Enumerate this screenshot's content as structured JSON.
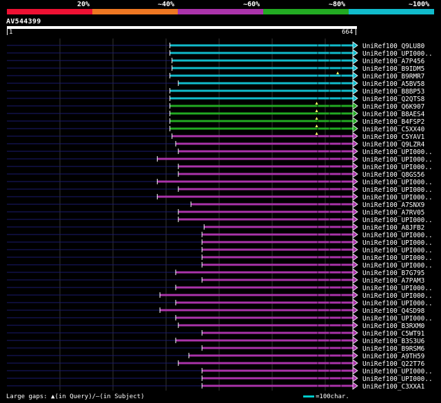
{
  "legend": {
    "labels": [
      "20%",
      "~40%",
      "~60%",
      "~80%",
      "~100%"
    ],
    "colors": [
      "#ee1133",
      "#ee7722",
      "#aa33aa",
      "#22aa22",
      "#11bbcc"
    ]
  },
  "query": {
    "name": "AV544399",
    "start": "1",
    "end": "664",
    "length": 664
  },
  "footer": {
    "gaps_text": "Large gaps: ▲(in Query)/—(in Subject)",
    "scale_text": "=100char."
  },
  "chart_data": {
    "type": "alignment",
    "x_range": [
      1,
      664
    ],
    "hits": [
      {
        "name": "UniRef100_Q9LU80",
        "start": 311,
        "class": "100",
        "query_gaps": []
      },
      {
        "name": "UniRef100_UPI000..",
        "start": 311,
        "class": "100",
        "query_gaps": []
      },
      {
        "name": "UniRef100_A7P456",
        "start": 315,
        "class": "100",
        "query_gaps": []
      },
      {
        "name": "UniRef100_B9IDM5",
        "start": 315,
        "class": "100",
        "query_gaps": []
      },
      {
        "name": "UniRef100_B9RMR7",
        "start": 311,
        "class": "100",
        "query_gaps": [
          630
        ]
      },
      {
        "name": "UniRef100_A5BV58",
        "start": 327,
        "class": "100",
        "query_gaps": []
      },
      {
        "name": "UniRef100_B8BP53",
        "start": 311,
        "class": "100",
        "query_gaps": []
      },
      {
        "name": "UniRef100_Q2QTS8",
        "start": 311,
        "class": "100",
        "query_gaps": []
      },
      {
        "name": "UniRef100_Q6K907",
        "start": 311,
        "class": "80",
        "query_gaps": [
          590
        ]
      },
      {
        "name": "UniRef100_B8AES4",
        "start": 311,
        "class": "80",
        "query_gaps": [
          590
        ]
      },
      {
        "name": "UniRef100_B4FSP2",
        "start": 311,
        "class": "80",
        "query_gaps": [
          590
        ]
      },
      {
        "name": "UniRef100_C5XX40",
        "start": 311,
        "class": "80",
        "query_gaps": [
          590
        ]
      },
      {
        "name": "UniRef100_C5YAV1",
        "start": 315,
        "class": "60",
        "query_gaps": [
          590
        ]
      },
      {
        "name": "UniRef100_Q9LZR4",
        "start": 322,
        "class": "60",
        "query_gaps": []
      },
      {
        "name": "UniRef100_UPI000..",
        "start": 327,
        "class": "60",
        "query_gaps": []
      },
      {
        "name": "UniRef100_UPI000..",
        "start": 287,
        "class": "60",
        "query_gaps": []
      },
      {
        "name": "UniRef100_UPI000..",
        "start": 327,
        "class": "60",
        "query_gaps": []
      },
      {
        "name": "UniRef100_Q8GS56",
        "start": 327,
        "class": "60",
        "query_gaps": []
      },
      {
        "name": "UniRef100_UPI000..",
        "start": 287,
        "class": "60",
        "query_gaps": []
      },
      {
        "name": "UniRef100_UPI000..",
        "start": 327,
        "class": "60",
        "query_gaps": []
      },
      {
        "name": "UniRef100_UPI000..",
        "start": 287,
        "class": "60",
        "query_gaps": []
      },
      {
        "name": "UniRef100_A7SNX9",
        "start": 351,
        "class": "60",
        "query_gaps": []
      },
      {
        "name": "UniRef100_A7RV05",
        "start": 327,
        "class": "60",
        "query_gaps": []
      },
      {
        "name": "UniRef100_UPI000..",
        "start": 327,
        "class": "60",
        "query_gaps": []
      },
      {
        "name": "UniRef100_A8JFB2",
        "start": 376,
        "class": "60",
        "query_gaps": []
      },
      {
        "name": "UniRef100_UPI000..",
        "start": 372,
        "class": "60",
        "query_gaps": []
      },
      {
        "name": "UniRef100_UPI000..",
        "start": 372,
        "class": "60",
        "query_gaps": []
      },
      {
        "name": "UniRef100_UPI000..",
        "start": 372,
        "class": "60",
        "query_gaps": []
      },
      {
        "name": "UniRef100_UPI000..",
        "start": 372,
        "class": "60",
        "query_gaps": []
      },
      {
        "name": "UniRef100_UPI000..",
        "start": 372,
        "class": "60",
        "query_gaps": []
      },
      {
        "name": "UniRef100_B7G795",
        "start": 322,
        "class": "60",
        "query_gaps": []
      },
      {
        "name": "UniRef100_A7PAM3",
        "start": 372,
        "class": "60",
        "query_gaps": []
      },
      {
        "name": "UniRef100_UPI000..",
        "start": 322,
        "class": "60",
        "query_gaps": []
      },
      {
        "name": "UniRef100_UPI000..",
        "start": 292,
        "class": "60",
        "query_gaps": []
      },
      {
        "name": "UniRef100_UPI000..",
        "start": 322,
        "class": "60",
        "query_gaps": []
      },
      {
        "name": "UniRef100_Q4SD98",
        "start": 292,
        "class": "60",
        "query_gaps": []
      },
      {
        "name": "UniRef100_UPI000..",
        "start": 322,
        "class": "60",
        "query_gaps": []
      },
      {
        "name": "UniRef100_B3RXM0",
        "start": 327,
        "class": "60",
        "query_gaps": []
      },
      {
        "name": "UniRef100_C5WT91",
        "start": 372,
        "class": "60",
        "query_gaps": []
      },
      {
        "name": "UniRef100_B3S3U6",
        "start": 322,
        "class": "60",
        "query_gaps": []
      },
      {
        "name": "UniRef100_B9RSM6",
        "start": 372,
        "class": "60",
        "query_gaps": []
      },
      {
        "name": "UniRef100_A9TH59",
        "start": 347,
        "class": "60",
        "query_gaps": []
      },
      {
        "name": "UniRef100_Q22T76",
        "start": 327,
        "class": "60",
        "query_gaps": []
      },
      {
        "name": "UniRef100_UPI000..",
        "start": 372,
        "class": "60",
        "query_gaps": []
      },
      {
        "name": "UniRef100_UPI000..",
        "start": 372,
        "class": "60",
        "query_gaps": []
      },
      {
        "name": "UniRef100_C3XXA1",
        "start": 372,
        "class": "60",
        "query_gaps": []
      }
    ]
  }
}
